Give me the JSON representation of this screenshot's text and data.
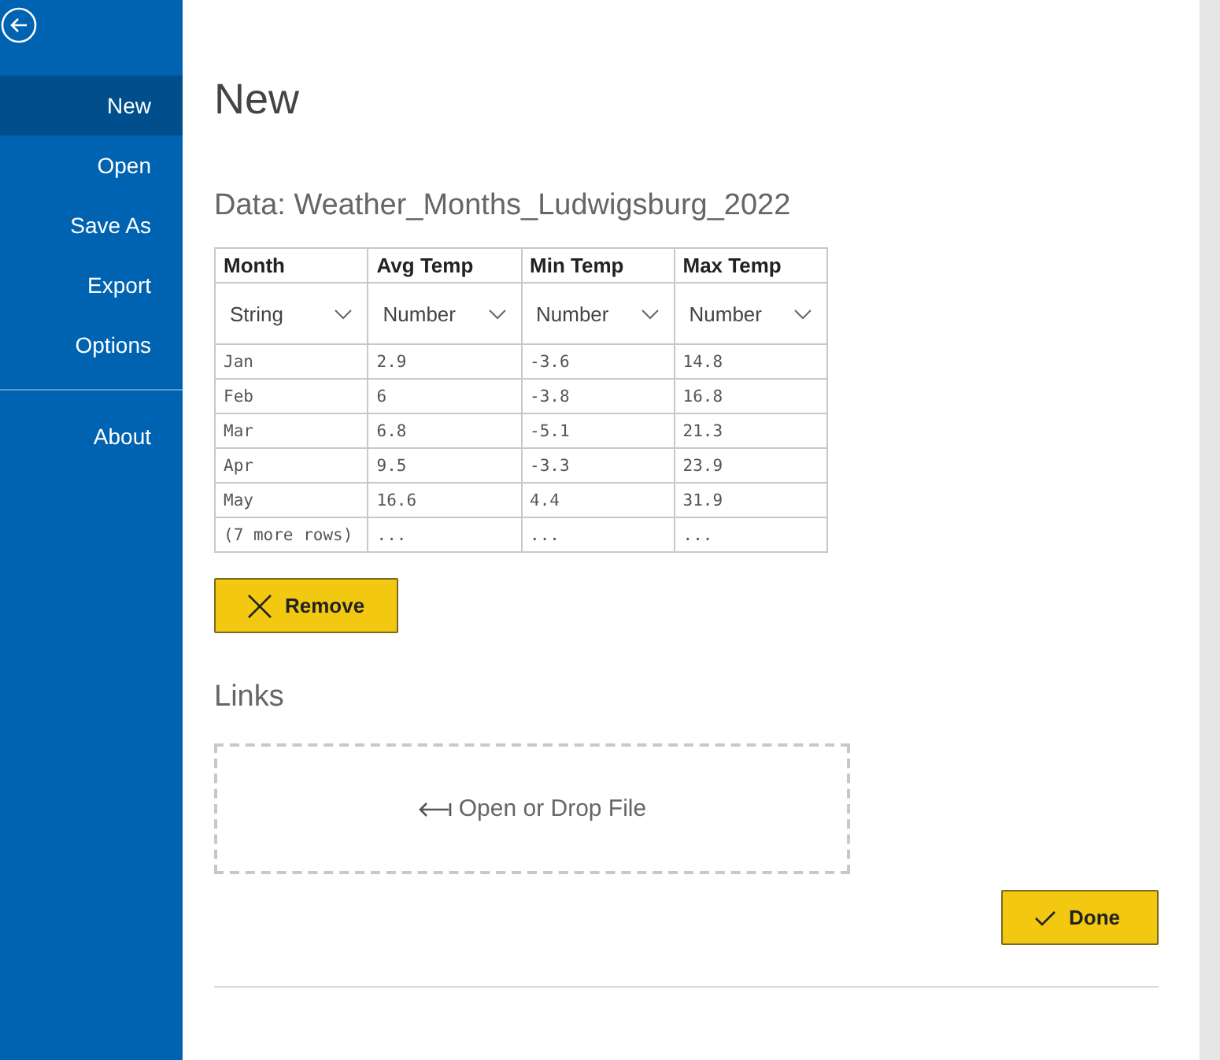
{
  "sidebar": {
    "items": [
      {
        "label": "New",
        "selected": true
      },
      {
        "label": "Open",
        "selected": false
      },
      {
        "label": "Save As",
        "selected": false
      },
      {
        "label": "Export",
        "selected": false
      },
      {
        "label": "Options",
        "selected": false
      }
    ],
    "footer_items": [
      {
        "label": "About",
        "selected": false
      }
    ]
  },
  "title": "New",
  "data_heading": "Data: Weather_Months_Ludwigsburg_2022",
  "table": {
    "columns": [
      {
        "name": "Month",
        "type": "String"
      },
      {
        "name": "Avg Temp",
        "type": "Number"
      },
      {
        "name": "Min Temp",
        "type": "Number"
      },
      {
        "name": "Max Temp",
        "type": "Number"
      }
    ],
    "rows": [
      [
        "Jan",
        "2.9",
        "-3.6",
        "14.8"
      ],
      [
        "Feb",
        "6",
        "-3.8",
        "16.8"
      ],
      [
        "Mar",
        "6.8",
        "-5.1",
        "21.3"
      ],
      [
        "Apr",
        "9.5",
        "-3.3",
        "23.9"
      ],
      [
        "May",
        "16.6",
        "4.4",
        "31.9"
      ],
      [
        "(7 more rows)",
        "...",
        "...",
        "..."
      ]
    ]
  },
  "remove_button": "Remove",
  "links_heading": "Links",
  "drop_zone": "Open or Drop File",
  "done_button": "Done"
}
